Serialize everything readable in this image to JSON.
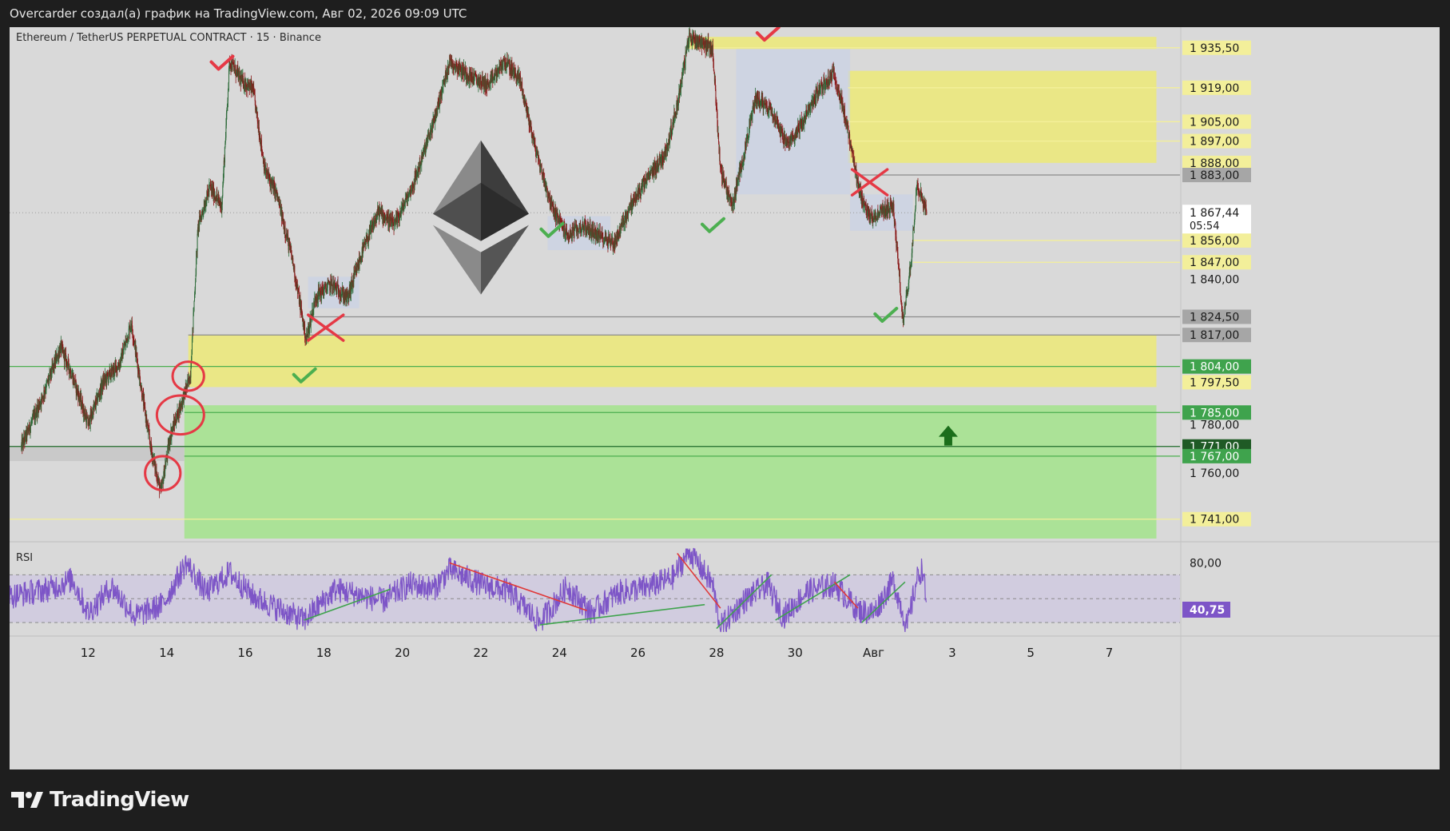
{
  "header": {
    "title": "Overcarder создал(а) график на TradingView.com, Авг 02, 2026 09:09 UTC"
  },
  "footer": {
    "brand": "TradingView",
    "logo_icon": "tradingview-logo-icon"
  },
  "colors": {
    "frame_bg": "#d9d9d9",
    "yellow_zone": "#ebe882",
    "green_zone": "#a9e394",
    "candle_up": "#2e6b3a",
    "candle_down": "#8a1a1a",
    "rsi_line": "#7d55c7",
    "rsi_band": "#cfc9df",
    "check_green": "#4caf50",
    "mark_red": "#e53945",
    "eth_logo": "#555555"
  },
  "chart_data": {
    "type": "line",
    "title": "Ethereum / TetherUS PERPETUAL CONTRACT · 15 · Binance",
    "subtitle": "",
    "xlabel": "",
    "ylabel": "",
    "ylim": [
      1733,
      1944
    ],
    "x_tick_labels": [
      {
        "label": "12",
        "day": 12
      },
      {
        "label": "14",
        "day": 14
      },
      {
        "label": "16",
        "day": 16
      },
      {
        "label": "18",
        "day": 18
      },
      {
        "label": "20",
        "day": 20
      },
      {
        "label": "22",
        "day": 22
      },
      {
        "label": "24",
        "day": 24
      },
      {
        "label": "26",
        "day": 26
      },
      {
        "label": "28",
        "day": 28
      },
      {
        "label": "30",
        "day": 30
      },
      {
        "label": "Авг",
        "day": 32
      },
      {
        "label": "3",
        "day": 34
      },
      {
        "label": "5",
        "day": 36
      },
      {
        "label": "7",
        "day": 38
      }
    ],
    "price_series": {
      "name": "ETHUSDT.P",
      "points": [
        {
          "day": 10.3,
          "price": 1771
        },
        {
          "day": 10.8,
          "price": 1790
        },
        {
          "day": 11.3,
          "price": 1812
        },
        {
          "day": 11.6,
          "price": 1800
        },
        {
          "day": 12.0,
          "price": 1780
        },
        {
          "day": 12.4,
          "price": 1798
        },
        {
          "day": 12.8,
          "price": 1805
        },
        {
          "day": 13.1,
          "price": 1822
        },
        {
          "day": 13.4,
          "price": 1790
        },
        {
          "day": 13.6,
          "price": 1770
        },
        {
          "day": 13.85,
          "price": 1752
        },
        {
          "day": 14.1,
          "price": 1776
        },
        {
          "day": 14.4,
          "price": 1790
        },
        {
          "day": 14.6,
          "price": 1800
        },
        {
          "day": 14.8,
          "price": 1862
        },
        {
          "day": 15.1,
          "price": 1878
        },
        {
          "day": 15.4,
          "price": 1870
        },
        {
          "day": 15.6,
          "price": 1930
        },
        {
          "day": 15.9,
          "price": 1922
        },
        {
          "day": 16.2,
          "price": 1918
        },
        {
          "day": 16.5,
          "price": 1885
        },
        {
          "day": 16.8,
          "price": 1875
        },
        {
          "day": 17.2,
          "price": 1848
        },
        {
          "day": 17.55,
          "price": 1815
        },
        {
          "day": 17.8,
          "price": 1833
        },
        {
          "day": 18.2,
          "price": 1838
        },
        {
          "day": 18.6,
          "price": 1832
        },
        {
          "day": 19.0,
          "price": 1852
        },
        {
          "day": 19.4,
          "price": 1868
        },
        {
          "day": 19.8,
          "price": 1862
        },
        {
          "day": 20.3,
          "price": 1880
        },
        {
          "day": 20.8,
          "price": 1905
        },
        {
          "day": 21.2,
          "price": 1930
        },
        {
          "day": 21.7,
          "price": 1924
        },
        {
          "day": 22.2,
          "price": 1920
        },
        {
          "day": 22.6,
          "price": 1930
        },
        {
          "day": 23.0,
          "price": 1922
        },
        {
          "day": 23.4,
          "price": 1893
        },
        {
          "day": 23.8,
          "price": 1870
        },
        {
          "day": 24.2,
          "price": 1858
        },
        {
          "day": 24.6,
          "price": 1862
        },
        {
          "day": 25.0,
          "price": 1858
        },
        {
          "day": 25.4,
          "price": 1855
        },
        {
          "day": 25.8,
          "price": 1870
        },
        {
          "day": 26.3,
          "price": 1883
        },
        {
          "day": 26.7,
          "price": 1892
        },
        {
          "day": 27.0,
          "price": 1912
        },
        {
          "day": 27.3,
          "price": 1940
        },
        {
          "day": 27.6,
          "price": 1938
        },
        {
          "day": 27.9,
          "price": 1935
        },
        {
          "day": 28.1,
          "price": 1885
        },
        {
          "day": 28.4,
          "price": 1870
        },
        {
          "day": 28.7,
          "price": 1892
        },
        {
          "day": 29.0,
          "price": 1915
        },
        {
          "day": 29.4,
          "price": 1910
        },
        {
          "day": 29.8,
          "price": 1895
        },
        {
          "day": 30.2,
          "price": 1905
        },
        {
          "day": 30.6,
          "price": 1918
        },
        {
          "day": 31.0,
          "price": 1925
        },
        {
          "day": 31.3,
          "price": 1905
        },
        {
          "day": 31.6,
          "price": 1878
        },
        {
          "day": 31.9,
          "price": 1865
        },
        {
          "day": 32.2,
          "price": 1868
        },
        {
          "day": 32.5,
          "price": 1870
        },
        {
          "day": 32.75,
          "price": 1822
        },
        {
          "day": 32.95,
          "price": 1847
        },
        {
          "day": 33.1,
          "price": 1880
        },
        {
          "day": 33.35,
          "price": 1867.44
        }
      ]
    },
    "current_price": {
      "price": 1867.44,
      "label": "1 867,44",
      "countdown": "05:54"
    },
    "price_axis_labels": [
      {
        "price": 1935.5,
        "label": "1 935,50",
        "style": "yellow"
      },
      {
        "price": 1919.0,
        "label": "1 919,00",
        "style": "yellow"
      },
      {
        "price": 1905.0,
        "label": "1 905,00",
        "style": "yellow"
      },
      {
        "price": 1897.0,
        "label": "1 897,00",
        "style": "yellow"
      },
      {
        "price": 1888.0,
        "label": "1 888,00",
        "style": "yellow"
      },
      {
        "price": 1883.0,
        "label": "1 883,00",
        "style": "gray"
      },
      {
        "price": 1856.0,
        "label": "1 856,00",
        "style": "yellow"
      },
      {
        "price": 1847.0,
        "label": "1 847,00",
        "style": "yellow"
      },
      {
        "price": 1840.0,
        "label": "1 840,00",
        "style": "plain"
      },
      {
        "price": 1824.5,
        "label": "1 824,50",
        "style": "gray"
      },
      {
        "price": 1817.0,
        "label": "1 817,00",
        "style": "gray"
      },
      {
        "price": 1804.0,
        "label": "1 804,00",
        "style": "green"
      },
      {
        "price": 1797.5,
        "label": "1 797,50",
        "style": "yellow"
      },
      {
        "price": 1785.0,
        "label": "1 785,00",
        "style": "green"
      },
      {
        "price": 1780.0,
        "label": "1 780,00",
        "style": "plain"
      },
      {
        "price": 1771.0,
        "label": "1 771,00",
        "style": "darkgreen"
      },
      {
        "price": 1767.0,
        "label": "1 767,00",
        "style": "green"
      },
      {
        "price": 1760.0,
        "label": "1 760,00",
        "style": "plain"
      },
      {
        "price": 1741.0,
        "label": "1 741,00",
        "style": "yellow"
      }
    ],
    "zones": [
      {
        "kind": "yellow",
        "day_start": 14.55,
        "day_end": 39.2,
        "price_low": 1795.5,
        "price_high": 1817
      },
      {
        "kind": "yellow",
        "day_start": 31.35,
        "day_end": 39.2,
        "price_low": 1888,
        "price_high": 1926
      },
      {
        "kind": "yellow",
        "day_start": 27.3,
        "day_end": 39.2,
        "price_low": 1935,
        "price_high": 1940
      },
      {
        "kind": "green",
        "day_start": 14.45,
        "day_end": 39.2,
        "price_low": 1733,
        "price_high": 1788
      }
    ],
    "levels": [
      {
        "price": 1804,
        "day_start": 10.0,
        "color": "#4caf50"
      },
      {
        "price": 1771,
        "day_start": 10.0,
        "color": "#1f6b2a"
      },
      {
        "price": 1785,
        "day_start": 14.45,
        "color": "#4caf50"
      },
      {
        "price": 1767,
        "day_start": 14.45,
        "color": "#4caf50"
      },
      {
        "price": 1741,
        "day_start": 10.0,
        "color": "#f3ef9a"
      },
      {
        "price": 1824.5,
        "day_start": 17.6,
        "color": "#8c8c8c"
      },
      {
        "price": 1817,
        "day_start": 14.55,
        "color": "#8c8c8c"
      },
      {
        "price": 1883,
        "day_start": 31.6,
        "color": "#8c8c8c"
      },
      {
        "price": 1856,
        "day_start": 33.0,
        "color": "#f3ef9a"
      },
      {
        "price": 1847,
        "day_start": 33.0,
        "color": "#f3ef9a"
      },
      {
        "price": 1919,
        "day_start": 31.35,
        "color": "#f3ef9a"
      },
      {
        "price": 1905,
        "day_start": 31.35,
        "color": "#f3ef9a"
      },
      {
        "price": 1897,
        "day_start": 31.35,
        "color": "#f3ef9a"
      },
      {
        "price": 1935.5,
        "day_start": 27.3,
        "color": "#f3ef9a"
      }
    ],
    "annotations": {
      "checks": [
        {
          "day": 15.4,
          "price": 1929,
          "color": "red"
        },
        {
          "day": 17.5,
          "price": 1800,
          "color": "green"
        },
        {
          "day": 23.8,
          "price": 1860,
          "color": "green"
        },
        {
          "day": 27.9,
          "price": 1862,
          "color": "green"
        },
        {
          "day": 29.3,
          "price": 1941,
          "color": "red"
        },
        {
          "day": 32.3,
          "price": 1825,
          "color": "green"
        }
      ],
      "crosses": [
        {
          "day": 18.05,
          "price": 1820
        },
        {
          "day": 31.9,
          "price": 1880
        }
      ],
      "circles": [
        {
          "day": 14.55,
          "price": 1800,
          "rx_days": 0.4,
          "ry_price": 6
        },
        {
          "day": 14.35,
          "price": 1784,
          "rx_days": 0.6,
          "ry_price": 8
        },
        {
          "day": 13.9,
          "price": 1760,
          "rx_days": 0.45,
          "ry_price": 7
        }
      ],
      "up_arrow": {
        "day": 33.9,
        "price": 1775,
        "color": "#1b6e1b"
      },
      "eth_logo": {
        "day": 22.0,
        "price": 1865
      }
    },
    "rsi": {
      "label": "RSI",
      "ylim": [
        20,
        95
      ],
      "upper": 70,
      "mid": 50,
      "lower": 30,
      "axis_label": {
        "value": 80,
        "label": "80,00"
      },
      "current": {
        "value": 40.75,
        "label": "40,75"
      },
      "anchors": [
        {
          "day": 10.0,
          "value": 52
        },
        {
          "day": 11.0,
          "value": 58
        },
        {
          "day": 11.6,
          "value": 66
        },
        {
          "day": 12.0,
          "value": 38
        },
        {
          "day": 12.6,
          "value": 60
        },
        {
          "day": 13.2,
          "value": 35
        },
        {
          "day": 13.9,
          "value": 45
        },
        {
          "day": 14.5,
          "value": 80
        },
        {
          "day": 15.0,
          "value": 55
        },
        {
          "day": 15.6,
          "value": 72
        },
        {
          "day": 16.2,
          "value": 52
        },
        {
          "day": 16.8,
          "value": 42
        },
        {
          "day": 17.5,
          "value": 32
        },
        {
          "day": 18.3,
          "value": 58
        },
        {
          "day": 19.5,
          "value": 48
        },
        {
          "day": 20.2,
          "value": 62
        },
        {
          "day": 20.8,
          "value": 58
        },
        {
          "day": 21.2,
          "value": 74
        },
        {
          "day": 22.0,
          "value": 62
        },
        {
          "day": 22.7,
          "value": 56
        },
        {
          "day": 23.5,
          "value": 30
        },
        {
          "day": 24.2,
          "value": 60
        },
        {
          "day": 24.8,
          "value": 38
        },
        {
          "day": 25.5,
          "value": 55
        },
        {
          "day": 26.3,
          "value": 60
        },
        {
          "day": 26.9,
          "value": 68
        },
        {
          "day": 27.3,
          "value": 90
        },
        {
          "day": 27.9,
          "value": 62
        },
        {
          "day": 28.1,
          "value": 26
        },
        {
          "day": 28.7,
          "value": 48
        },
        {
          "day": 29.3,
          "value": 62
        },
        {
          "day": 29.7,
          "value": 35
        },
        {
          "day": 30.3,
          "value": 56
        },
        {
          "day": 31.0,
          "value": 62
        },
        {
          "day": 31.6,
          "value": 40
        },
        {
          "day": 32.0,
          "value": 38
        },
        {
          "day": 32.5,
          "value": 65
        },
        {
          "day": 32.85,
          "value": 26
        },
        {
          "day": 33.1,
          "value": 66
        },
        {
          "day": 33.25,
          "value": 76
        },
        {
          "day": 33.35,
          "value": 40.75
        }
      ],
      "trendlines": [
        {
          "color": "green",
          "from": {
            "day": 17.5,
            "value": 32
          },
          "to": {
            "day": 19.7,
            "value": 58
          }
        },
        {
          "color": "red",
          "from": {
            "day": 21.2,
            "value": 80
          },
          "to": {
            "day": 24.7,
            "value": 40
          }
        },
        {
          "color": "green",
          "from": {
            "day": 23.5,
            "value": 28
          },
          "to": {
            "day": 27.7,
            "value": 45
          }
        },
        {
          "color": "red",
          "from": {
            "day": 27.0,
            "value": 88
          },
          "to": {
            "day": 28.1,
            "value": 42
          }
        },
        {
          "color": "green",
          "from": {
            "day": 28.0,
            "value": 25
          },
          "to": {
            "day": 29.4,
            "value": 70
          }
        },
        {
          "color": "green",
          "from": {
            "day": 29.5,
            "value": 32
          },
          "to": {
            "day": 31.4,
            "value": 70
          }
        },
        {
          "color": "red",
          "from": {
            "day": 31.0,
            "value": 64
          },
          "to": {
            "day": 31.6,
            "value": 42
          }
        },
        {
          "color": "green",
          "from": {
            "day": 31.7,
            "value": 30
          },
          "to": {
            "day": 32.8,
            "value": 64
          }
        }
      ]
    }
  }
}
